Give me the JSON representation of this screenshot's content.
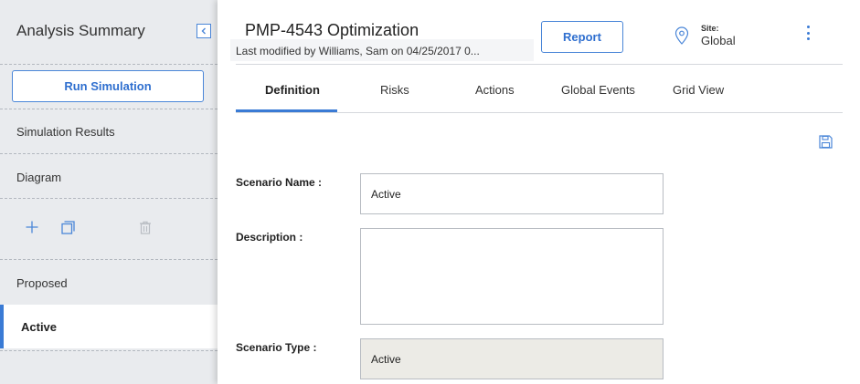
{
  "sidebar": {
    "title": "Analysis Summary",
    "run_button": "Run Simulation",
    "items": [
      {
        "label": "Simulation Results"
      },
      {
        "label": "Diagram"
      }
    ],
    "scenarios": [
      {
        "label": "Proposed",
        "active": false
      },
      {
        "label": "Active",
        "active": true
      }
    ],
    "tools": [
      "plus-icon",
      "copy-icon",
      "trash-icon"
    ]
  },
  "header": {
    "title": "PMP-4543 Optimization",
    "modified": "Last modified by Williams, Sam on 04/25/2017 0...",
    "report_button": "Report",
    "site_label": "Site:",
    "site_value": "Global"
  },
  "tabs": [
    {
      "label": "Definition",
      "active": true
    },
    {
      "label": "Risks",
      "active": false
    },
    {
      "label": "Actions",
      "active": false
    },
    {
      "label": "Global Events",
      "active": false
    },
    {
      "label": "Grid View",
      "active": false
    }
  ],
  "form": {
    "scenario_name_label": "Scenario Name :",
    "scenario_name_value": "Active",
    "description_label": "Description :",
    "description_value": "",
    "scenario_type_label": "Scenario Type :",
    "scenario_type_value": "Active"
  },
  "colors": {
    "accent": "#3a7bd5",
    "sidebar_bg": "#e9ebee",
    "readonly_bg": "#ecebe6"
  }
}
